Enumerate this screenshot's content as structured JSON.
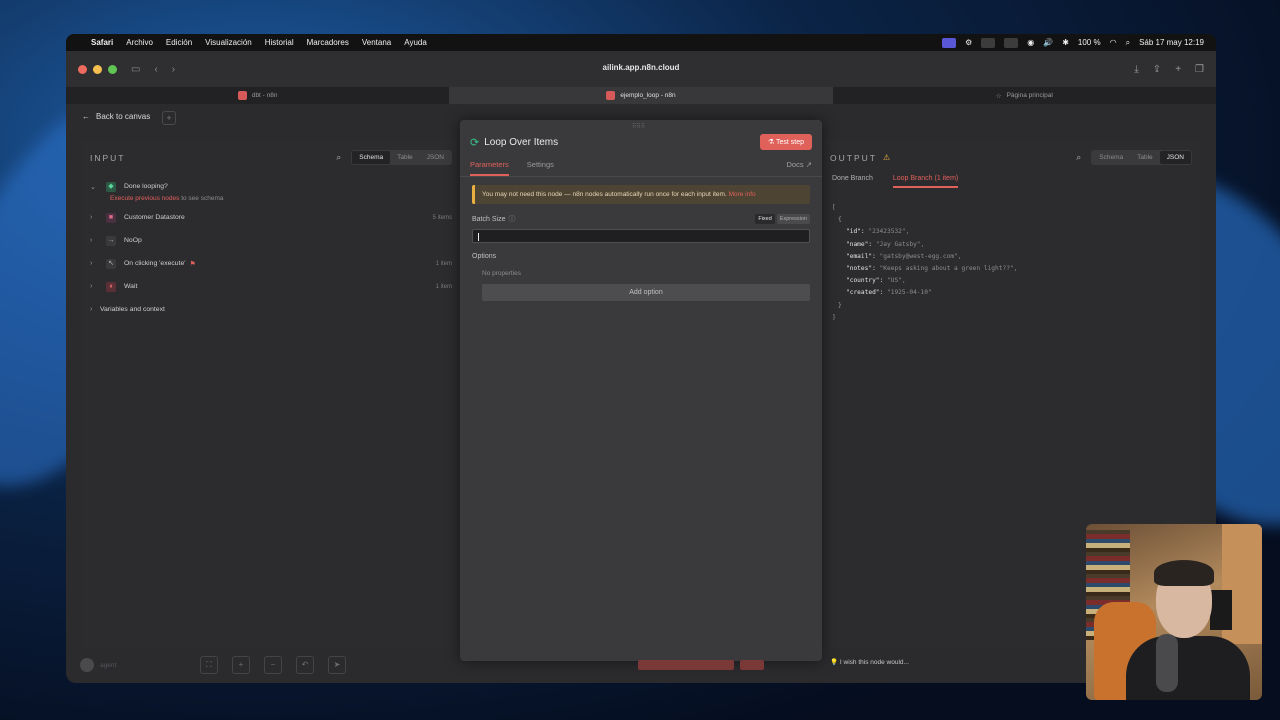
{
  "menubar": {
    "app": "Safari",
    "items": [
      "Archivo",
      "Edición",
      "Visualización",
      "Historial",
      "Marcadores",
      "Ventana",
      "Ayuda"
    ],
    "battery": "100 %",
    "datetime": "Sáb 17 may 12:19"
  },
  "browser": {
    "url": "ailink.app.n8n.cloud",
    "tabs": [
      {
        "label": "dbt - n8n"
      },
      {
        "label": "ejemplo_loop - n8n"
      },
      {
        "label": "Página principal"
      }
    ]
  },
  "canvas": {
    "back_label": "Back to canvas"
  },
  "input": {
    "title": "INPUT",
    "views": [
      "Schema",
      "Table",
      "JSON"
    ],
    "selected_view": "Schema",
    "nodes": [
      {
        "label": "Done looping?",
        "count": ""
      },
      {
        "label": "Customer Datastore",
        "count": "5 items"
      },
      {
        "label": "NoOp",
        "count": ""
      },
      {
        "label": "On clicking 'execute'",
        "count": "1 item"
      },
      {
        "label": "Wait",
        "count": "1 item"
      }
    ],
    "hint_link": "Execute previous nodes",
    "hint_rest": "to see schema",
    "variables_label": "Variables and context"
  },
  "node": {
    "title": "Loop Over Items",
    "test_button": "Test step",
    "tabs": [
      "Parameters",
      "Settings"
    ],
    "docs": "Docs",
    "warning": "You may not need this node — n8n nodes automatically run once for each input item.",
    "warning_link": "More info",
    "batch_label": "Batch Size",
    "fixed": "Fixed",
    "expression": "Expression",
    "batch_value": "",
    "options_label": "Options",
    "no_properties": "No properties",
    "add_option": "Add option"
  },
  "output": {
    "title": "OUTPUT",
    "views": [
      "Schema",
      "Table",
      "JSON"
    ],
    "selected_view": "JSON",
    "branches": [
      "Done Branch",
      "Loop Branch (1 item)"
    ],
    "json": {
      "open_bracket": "[",
      "open_brace": "{",
      "close_brace": "}",
      "close_bracket": "]",
      "fields": [
        {
          "key": "\"id\":",
          "value": "\"23423532\","
        },
        {
          "key": "\"name\":",
          "value": "\"Jay Gatsby\","
        },
        {
          "key": "\"email\":",
          "value": "\"gatsby@west-egg.com\","
        },
        {
          "key": "\"notes\":",
          "value": "\"Keeps asking about a green light??\","
        },
        {
          "key": "\"country\":",
          "value": "\"US\","
        },
        {
          "key": "\"created\":",
          "value": "\"1925-04-10\""
        }
      ]
    }
  },
  "bottom": {
    "wish": "I wish this node would...",
    "agent": "agent"
  }
}
